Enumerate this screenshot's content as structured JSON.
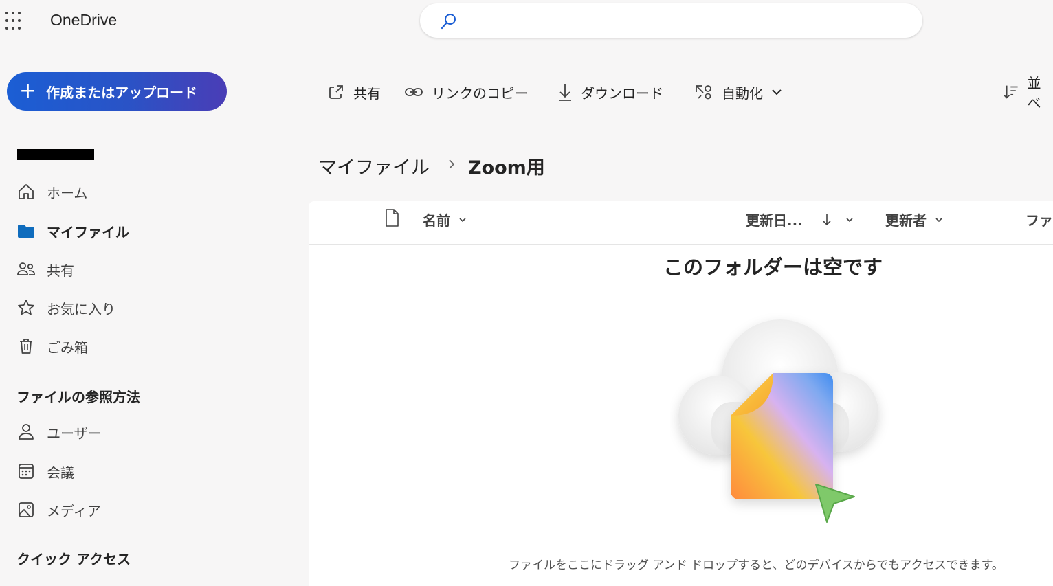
{
  "app": {
    "title": "OneDrive"
  },
  "search": {
    "placeholder": ""
  },
  "create_button": {
    "label": "作成またはアップロード"
  },
  "toolbar": {
    "share": "共有",
    "copy_link": "リンクのコピー",
    "download": "ダウンロード",
    "automate": "自動化",
    "sort": "並べ"
  },
  "sidebar": {
    "nav": [
      {
        "label": "ホーム",
        "icon": "home-icon"
      },
      {
        "label": "マイファイル",
        "icon": "folder-icon",
        "active": true
      },
      {
        "label": "共有",
        "icon": "people-icon"
      },
      {
        "label": "お気に入り",
        "icon": "star-icon"
      },
      {
        "label": "ごみ箱",
        "icon": "trash-icon"
      }
    ],
    "browse_heading": "ファイルの参照方法",
    "browse": [
      {
        "label": "ユーザー",
        "icon": "person-icon"
      },
      {
        "label": "会議",
        "icon": "calendar-icon"
      },
      {
        "label": "メディア",
        "icon": "image-icon"
      }
    ],
    "quick_access_heading": "クイック アクセス"
  },
  "breadcrumb": {
    "root": "マイファイル",
    "current": "Zoom用"
  },
  "columns": {
    "name": "名前",
    "modified": "更新日...",
    "modified_by": "更新者",
    "file_size": "ファ"
  },
  "empty_state": {
    "title": "このフォルダーは空です",
    "subtitle": "ファイルをここにドラッグ アンド ドロップすると、どのデバイスからでもアクセスできます。"
  },
  "colors": {
    "accent": "#1b5ed4",
    "folder": "#0f6cbd"
  }
}
